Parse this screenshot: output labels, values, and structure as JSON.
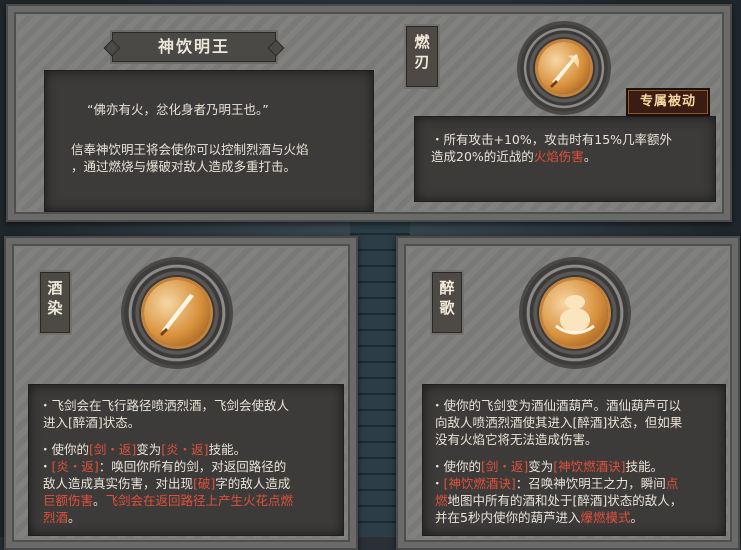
{
  "top_panel": {
    "title": "神饮明王",
    "quote": "“佛亦有火，忿化身者乃明王也。”",
    "description_line1": "信奉神饮明王将会使你可以控制烈酒与火焰",
    "description_line2": "，通过燃烧与爆破对敌人造成多重打击。",
    "skill_tag": [
      "燃",
      "刃"
    ],
    "badge": "专属被动",
    "passive_line1": "・所有攻击+10%，攻击时有15%几率额外",
    "passive_line2_prefix": "造成20%的近战的",
    "passive_line2_red": "火焰伤害",
    "passive_line2_suffix": "。",
    "icon": "flaming-sword-icon"
  },
  "left_panel": {
    "skill_tag": [
      "酒",
      "染"
    ],
    "icon": "sword-icon",
    "bullet1_line1": "・飞剑会在飞行路径喷洒烈酒，飞剑会使敌人",
    "bullet1_line2": "进入[醉酒]状态。",
    "bullet2_prefix": "・使你的",
    "bullet2_red1": "[剑・返]",
    "bullet2_mid": "变为",
    "bullet2_red2": "[炎・返]",
    "bullet2_suffix": "技能。",
    "bullet3_red": "[炎・返]",
    "bullet3_text1": "：唤回你所有的剑，对返回路径的",
    "bullet3_line2_prefix": "敌人造成真实伤害，对出现",
    "bullet3_line2_red": "[破]",
    "bullet3_line2_suffix": "字的敌人造成",
    "bullet3_line3_red1": "巨额伤害",
    "bullet3_line3_text": "。",
    "bullet3_line3_red2": "飞剑会在返回路径上产生火花点燃",
    "bullet3_line4_red": "烈酒",
    "bullet3_line4_suffix": "。"
  },
  "right_panel": {
    "skill_tag": [
      "醉",
      "歌"
    ],
    "icon": "wine-gourd-icon",
    "bullet1_line1": "・使你的飞剑变为酒仙酒葫芦。酒仙葫芦可以",
    "bullet1_line2": "向敌人喷洒烈酒使其进入[醉酒]状态，但如果",
    "bullet1_line3": "没有火焰它将无法造成伤害。",
    "bullet2_prefix": "・使你的",
    "bullet2_red1": "[剑・返]",
    "bullet2_mid": "变为",
    "bullet2_red2": "[神饮燃酒诀]",
    "bullet2_suffix": "技能。",
    "bullet3_red1": "[神饮燃酒诀]",
    "bullet3_text1": "：召唤神饮明王之力，瞬间",
    "bullet3_red2": "点",
    "bullet3_line2_red": "燃",
    "bullet3_line2_text": "地图中所有的酒和处于[醉酒]状态的敌人，",
    "bullet3_line3_prefix": "并在5秒内使你的葫芦进入",
    "bullet3_line3_red": "爆燃模式",
    "bullet3_line3_suffix": "。"
  },
  "colors": {
    "highlight": "#e0503a",
    "panel": "#7d7d7c",
    "inner": "#3d3b3a"
  }
}
